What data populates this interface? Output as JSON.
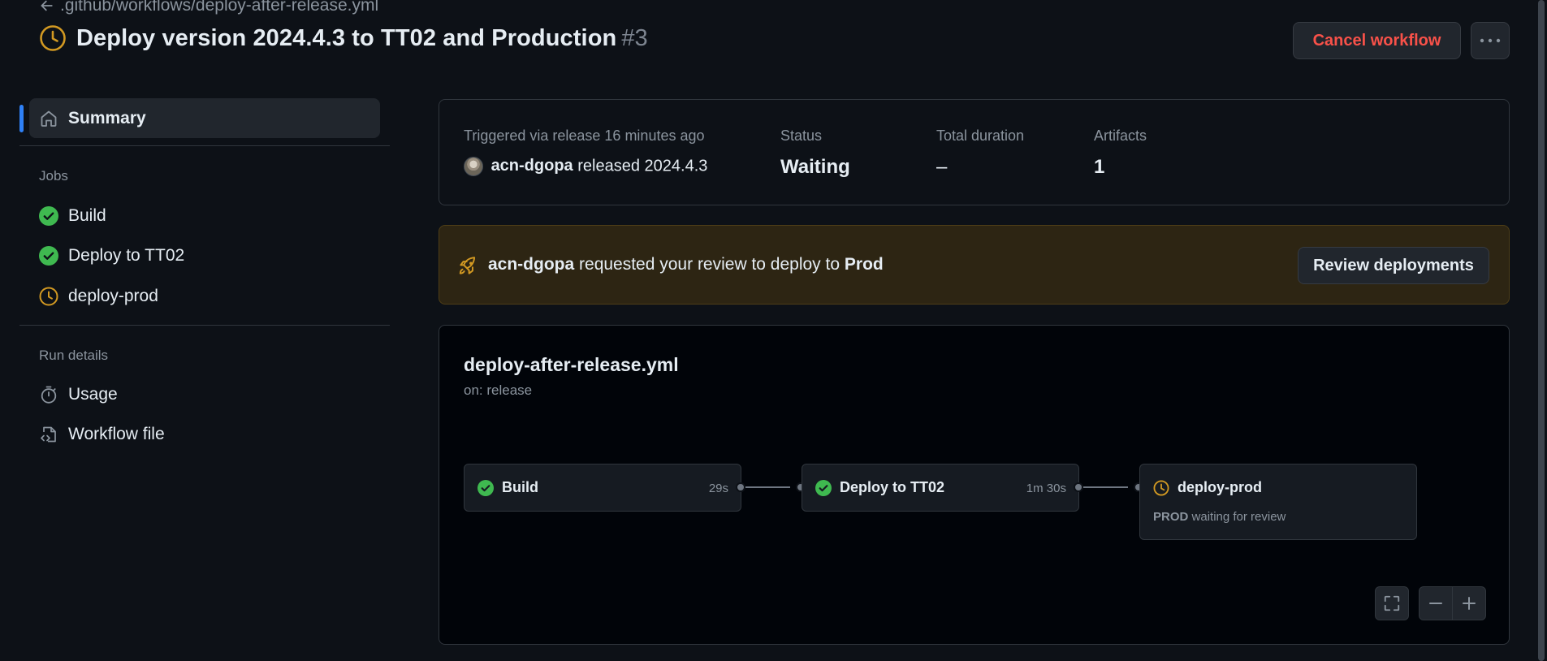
{
  "header": {
    "back_label": ".github/workflows/deploy-after-release.yml",
    "title": "Deploy version 2024.4.3 to TT02 and Production",
    "run_number": "#3",
    "cancel_label": "Cancel workflow",
    "status_icon": "clock-icon",
    "status_color": "#d29922"
  },
  "sidebar": {
    "summary_label": "Summary",
    "jobs_heading": "Jobs",
    "jobs": [
      {
        "label": "Build",
        "status": "success"
      },
      {
        "label": "Deploy to TT02",
        "status": "success"
      },
      {
        "label": "deploy-prod",
        "status": "waiting"
      }
    ],
    "run_details_heading": "Run details",
    "run_details": [
      {
        "label": "Usage",
        "icon": "stopwatch-icon"
      },
      {
        "label": "Workflow file",
        "icon": "file-code-icon"
      }
    ]
  },
  "summary": {
    "trigger_label": "Triggered via release 16 minutes ago",
    "actor": "acn-dgopa",
    "actor_action": "released 2024.4.3",
    "status_label": "Status",
    "status_value": "Waiting",
    "duration_label": "Total duration",
    "duration_value": "–",
    "artifacts_label": "Artifacts",
    "artifacts_value": "1"
  },
  "review": {
    "actor": "acn-dgopa",
    "text": "requested your review to deploy to",
    "environment": "Prod",
    "button_label": "Review deployments"
  },
  "graph": {
    "title": "deploy-after-release.yml",
    "subtitle": "on: release",
    "jobs": [
      {
        "name": "Build",
        "duration": "29s",
        "status": "success"
      },
      {
        "name": "Deploy to TT02",
        "duration": "1m 30s",
        "status": "success"
      },
      {
        "name": "deploy-prod",
        "status": "waiting",
        "detail_env": "PROD",
        "detail_text": "waiting for review"
      }
    ]
  },
  "colors": {
    "success": "#3fb950",
    "waiting": "#d29922",
    "danger": "#f85149",
    "accent": "#2f81f7"
  }
}
